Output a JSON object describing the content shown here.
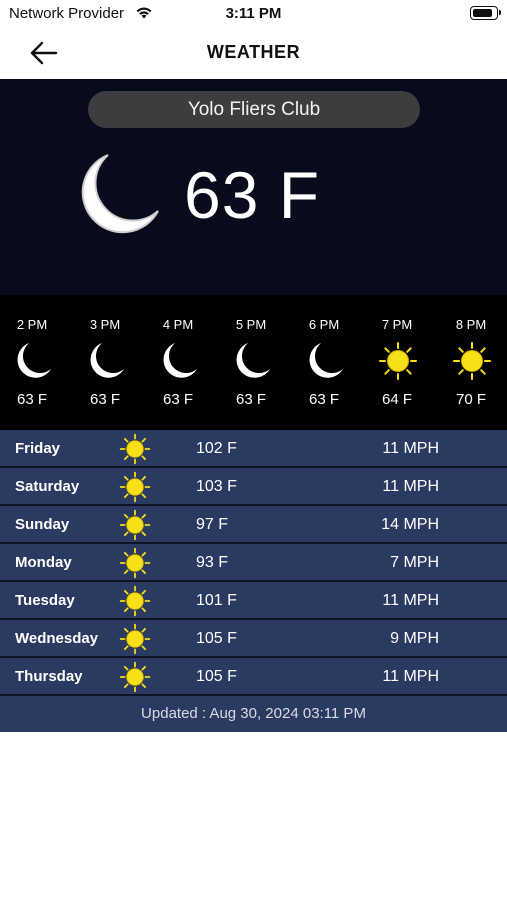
{
  "status_bar": {
    "carrier": "Network Provider",
    "time": "3:11 PM"
  },
  "nav": {
    "title": "WEATHER",
    "back_icon": "arrow-left-icon"
  },
  "current": {
    "location": "Yolo Fliers Club",
    "icon": "moon-icon",
    "temperature": "63 F"
  },
  "hourly": [
    {
      "time": "2 PM",
      "icon": "moon",
      "temp": "63 F"
    },
    {
      "time": "3 PM",
      "icon": "moon",
      "temp": "63 F"
    },
    {
      "time": "4 PM",
      "icon": "moon",
      "temp": "63 F"
    },
    {
      "time": "5 PM",
      "icon": "moon",
      "temp": "63 F"
    },
    {
      "time": "6 PM",
      "icon": "moon",
      "temp": "63 F"
    },
    {
      "time": "7 PM",
      "icon": "sun",
      "temp": "64 F"
    },
    {
      "time": "8 PM",
      "icon": "sun",
      "temp": "70 F"
    }
  ],
  "daily": [
    {
      "day": "Friday",
      "icon": "sun",
      "temp": "102 F",
      "wind": "11 MPH"
    },
    {
      "day": "Saturday",
      "icon": "sun",
      "temp": "103 F",
      "wind": "11 MPH"
    },
    {
      "day": "Sunday",
      "icon": "sun",
      "temp": "97 F",
      "wind": "14 MPH"
    },
    {
      "day": "Monday",
      "icon": "sun",
      "temp": "93 F",
      "wind": "7 MPH"
    },
    {
      "day": "Tuesday",
      "icon": "sun",
      "temp": "101 F",
      "wind": "11 MPH"
    },
    {
      "day": "Wednesday",
      "icon": "sun",
      "temp": "105 F",
      "wind": "9 MPH"
    },
    {
      "day": "Thursday",
      "icon": "sun",
      "temp": "105 F",
      "wind": "11 MPH"
    }
  ],
  "updated": "Updated : Aug 30, 2024 03:11 PM",
  "colors": {
    "current_bg": "#070b1c",
    "hourly_bg": "#000000",
    "daily_bg": "#2b3a61",
    "sun": "#f7e017",
    "location_pill": "#3d3d40"
  }
}
